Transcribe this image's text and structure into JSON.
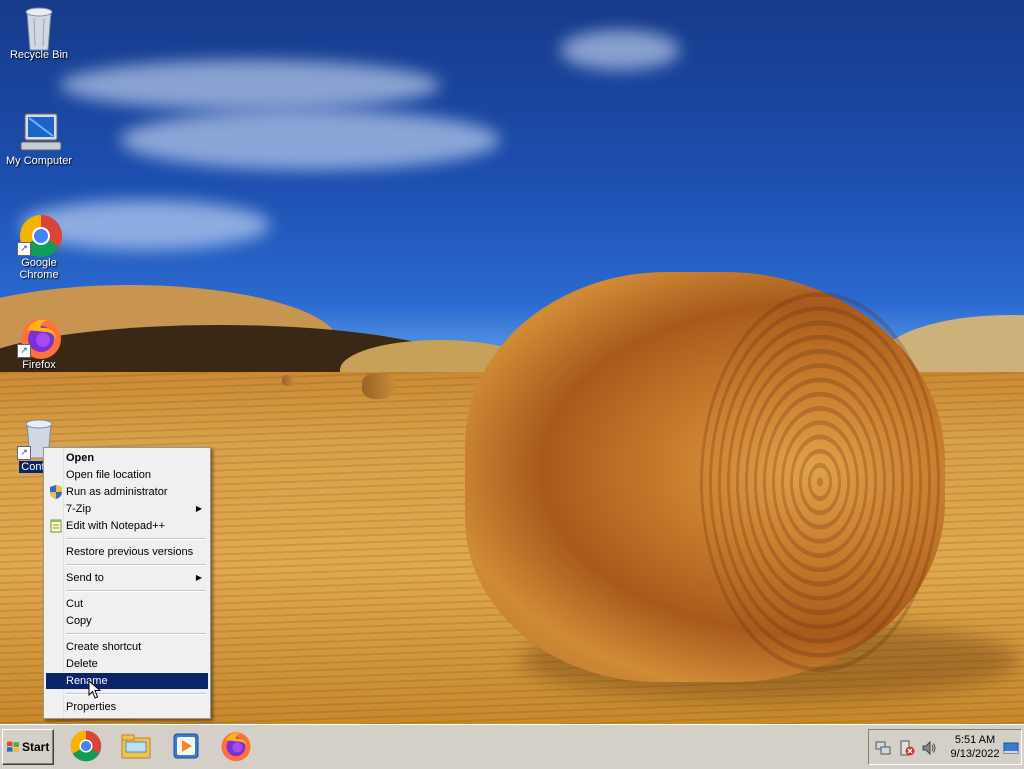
{
  "desktop": {
    "icons": [
      {
        "label": "Recycle Bin"
      },
      {
        "label": "My Computer"
      },
      {
        "label": "Google Chrome"
      },
      {
        "label": "Firefox"
      },
      {
        "label": "Control"
      }
    ]
  },
  "context_menu": {
    "items": [
      {
        "label": "Open"
      },
      {
        "label": "Open file location"
      },
      {
        "label": "Run as administrator"
      },
      {
        "label": "7-Zip"
      },
      {
        "label": "Edit with Notepad++"
      },
      {
        "label": "Restore previous versions"
      },
      {
        "label": "Send to"
      },
      {
        "label": "Cut"
      },
      {
        "label": "Copy"
      },
      {
        "label": "Create shortcut"
      },
      {
        "label": "Delete"
      },
      {
        "label": "Rename"
      },
      {
        "label": "Properties"
      }
    ],
    "highlighted": "Rename"
  },
  "taskbar": {
    "start_label": "Start",
    "pinned": [
      "chrome-icon",
      "file-explorer-icon",
      "media-player-icon",
      "firefox-icon"
    ],
    "tray_icons": [
      "network-icon",
      "action-center-icon",
      "volume-icon"
    ],
    "time": "5:51 AM",
    "date": "9/13/2022"
  },
  "colors": {
    "selection": "#0a246a",
    "taskbar": "#d4d0c8",
    "menu_bg": "#f0f0f0"
  }
}
